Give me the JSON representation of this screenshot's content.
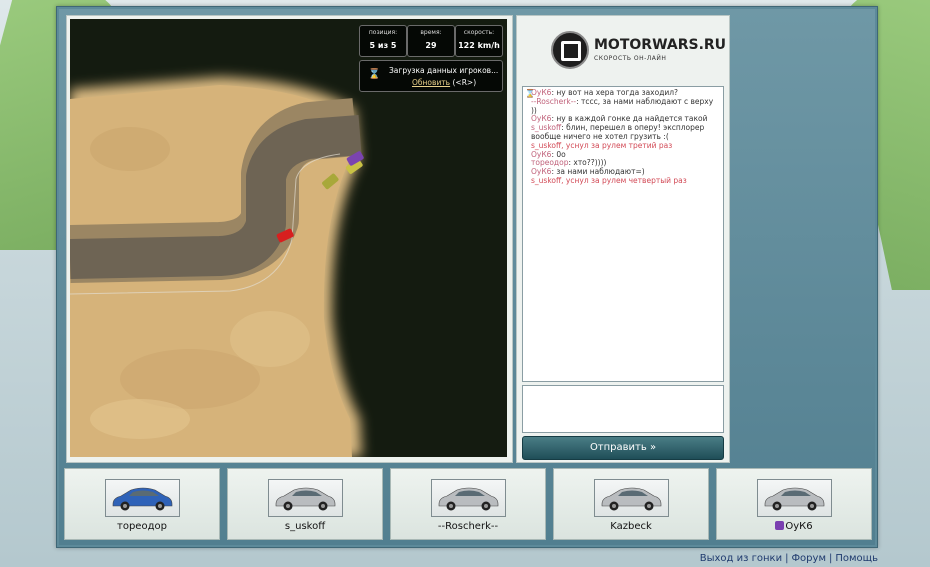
{
  "hud": {
    "position_label": "позиция:",
    "position_value": "5 из 5",
    "time_label": "время:",
    "time_value": "29",
    "speed_label": "скорость:",
    "speed_value": "122 km/h",
    "loading_text": "Загрузка данных игроков...",
    "refresh_link": "Обновить",
    "refresh_key": "(<R>)"
  },
  "logo": {
    "title": "MOTORWARS.RU",
    "subtitle": "СКОРОСТЬ ОН-ЛАЙН"
  },
  "chat": {
    "messages": [
      {
        "name": "ОуК6",
        "text": ": ну вот на хера тогда заходил?",
        "system": false
      },
      {
        "name": "--Roscherk--",
        "text": ": тссс, за нами наблюдают с верху ))",
        "system": false
      },
      {
        "name": "ОуК6",
        "text": ": ну в каждой гонке да найдется такой",
        "system": false
      },
      {
        "name": "s_uskoff",
        "text": ": блин, перешел в оперу! эксплорер вообще ничего не хотел грузить :(",
        "system": false
      },
      {
        "name": "",
        "text": "s_uskoff, уснул за рулем третий раз",
        "system": true
      },
      {
        "name": "ОуК6",
        "text": ": 0о",
        "system": false
      },
      {
        "name": "тореодор",
        "text": ": хто??))))",
        "system": false
      },
      {
        "name": "ОуК6",
        "text": ": за нами наблюдают=)",
        "system": false
      },
      {
        "name": "",
        "text": "s_uskoff, уснул за рулем четвертый раз",
        "system": true
      }
    ],
    "send_label": "Отправить »"
  },
  "players": [
    {
      "name": "тореодор",
      "car_color": "#2f62b8",
      "badge": false
    },
    {
      "name": "s_uskoff",
      "car_color": "#b9bcbf",
      "badge": false
    },
    {
      "name": "--Roscherk--",
      "car_color": "#b9bcbf",
      "badge": false
    },
    {
      "name": "Kazbeck",
      "car_color": "#b9bcbf",
      "badge": false
    },
    {
      "name": "ОуК6",
      "car_color": "#b9bcbf",
      "badge": true
    }
  ],
  "footer": {
    "exit_link": "Выход из гонки",
    "forum_link": "Форум",
    "help_link": "Помощь"
  },
  "colors": {
    "frame": "#5d8a9a",
    "send_button": "#1f4e58",
    "chat_name": "#c0617a",
    "chat_system": "#d24a56",
    "footer_link": "#1f3a6e"
  }
}
